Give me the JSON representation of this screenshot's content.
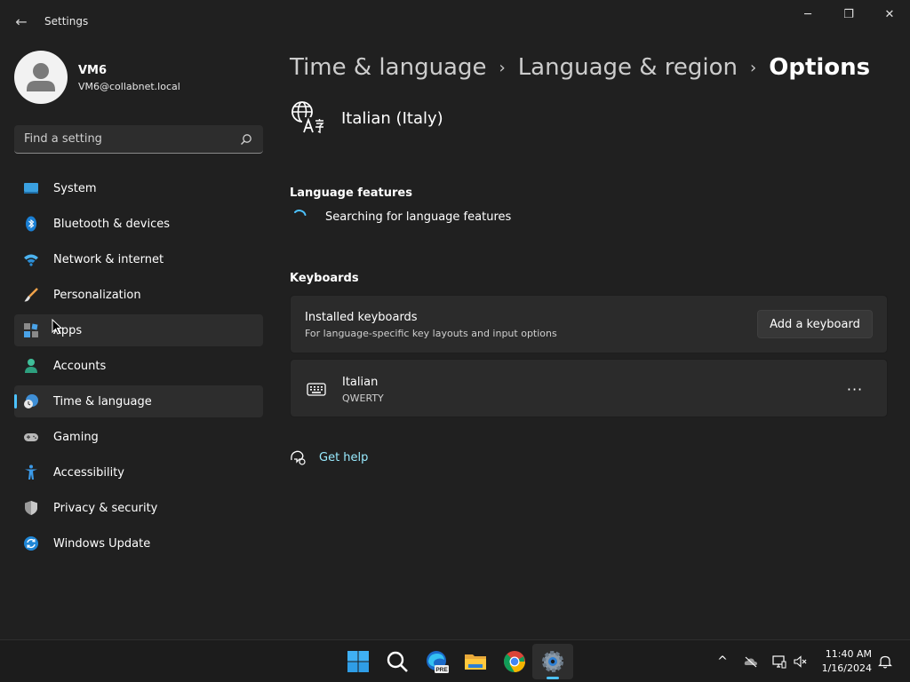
{
  "window": {
    "app_title": "Settings",
    "minimize_glyph": "─",
    "maximize_glyph": "❐",
    "close_glyph": "✕",
    "back_glyph": "←"
  },
  "profile": {
    "name": "VM6",
    "email": "VM6@collabnet.local"
  },
  "search": {
    "placeholder": "Find a setting",
    "value": ""
  },
  "sidebar": {
    "items": [
      {
        "label": "System",
        "icon": "monitor-icon"
      },
      {
        "label": "Bluetooth & devices",
        "icon": "bluetooth-icon"
      },
      {
        "label": "Network & internet",
        "icon": "wifi-icon"
      },
      {
        "label": "Personalization",
        "icon": "brush-icon"
      },
      {
        "label": "Apps",
        "icon": "apps-icon",
        "hovered": true
      },
      {
        "label": "Accounts",
        "icon": "person-icon"
      },
      {
        "label": "Time & language",
        "icon": "globe-clock-icon",
        "selected": true
      },
      {
        "label": "Gaming",
        "icon": "gamepad-icon"
      },
      {
        "label": "Accessibility",
        "icon": "accessibility-icon"
      },
      {
        "label": "Privacy & security",
        "icon": "shield-icon"
      },
      {
        "label": "Windows Update",
        "icon": "update-icon"
      }
    ]
  },
  "breadcrumb": {
    "items": [
      "Time & language",
      "Language & region",
      "Options"
    ],
    "separator": "›"
  },
  "language": {
    "title": "Italian (Italy)"
  },
  "language_features": {
    "heading": "Language features",
    "status": "Searching for language features"
  },
  "keyboards": {
    "heading": "Keyboards",
    "installed_title": "Installed keyboards",
    "installed_sub": "For language-specific key layouts and input options",
    "add_button": "Add a keyboard",
    "items": [
      {
        "name": "Italian",
        "layout": "QWERTY"
      }
    ],
    "more_glyph": "···"
  },
  "help": {
    "label": "Get help"
  },
  "taskbar": {
    "apps": [
      "start-icon",
      "search-icon",
      "edge-icon",
      "file-explorer-icon",
      "chrome-icon",
      "settings-icon"
    ],
    "pre_badge": "PRE",
    "chevron_glyph": "^",
    "time": "11:40 AM",
    "date": "1/16/2024"
  },
  "colors": {
    "accent": "#4cc2ff",
    "link": "#99ebff",
    "background": "#202020",
    "card": "#2b2b2b"
  }
}
